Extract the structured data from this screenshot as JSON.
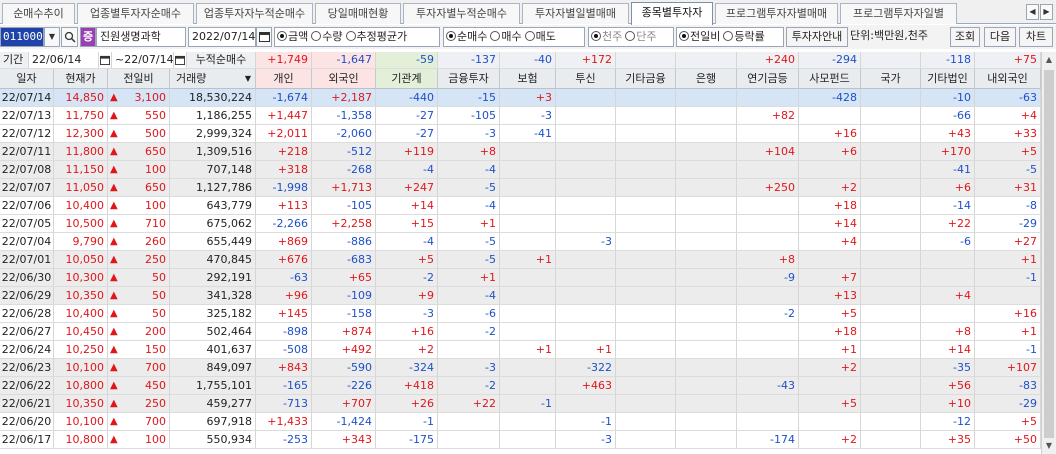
{
  "tabs": [
    "순매수추이",
    "업종별투자자순매수",
    "업종투자자누적순매수",
    "당일매매현황",
    "투자자별누적순매수",
    "투자자별일별매매",
    "종목별투자자",
    "프로그램투자자별매매",
    "프로그램투자자일별"
  ],
  "active_tab": 6,
  "toolbar": {
    "code": "011000",
    "stock_badge": "증",
    "stock_name": "진원생명과학",
    "date": "2022/07/14",
    "radio1": [
      {
        "label": "금액",
        "on": true
      },
      {
        "label": "수량",
        "on": false
      },
      {
        "label": "추정평균가",
        "on": false
      }
    ],
    "radio2": [
      {
        "label": "순매수",
        "on": true
      },
      {
        "label": "매수",
        "on": false
      },
      {
        "label": "매도",
        "on": false
      }
    ],
    "radio3": [
      {
        "label": "천주",
        "on": true
      },
      {
        "label": "단주",
        "on": false
      }
    ],
    "radio4": [
      {
        "label": "전일비",
        "on": true
      },
      {
        "label": "등락률",
        "on": false
      }
    ],
    "investor_info": "투자자안내",
    "unit_label": "단위:백만원,천주",
    "search": "조회",
    "next": "다음",
    "chart": "차트"
  },
  "period": {
    "label": "기간",
    "from": "22/06/14",
    "sep": "~",
    "to": "22/07/14",
    "sum_label": "누적순매수"
  },
  "summary": {
    "개인": "+1,749",
    "외국인": "-1,647",
    "기관계": "-59",
    "금융투자": "-137",
    "보험": "-40",
    "투신": "+172",
    "기타금융": "",
    "은행": "",
    "연기금등": "+240",
    "사모펀드": "-294",
    "국가": "",
    "기타법인": "-118",
    "내외국인": "+75"
  },
  "columns": [
    "일자",
    "현재가",
    "전일비",
    "거래량",
    "개인",
    "외국인",
    "기관계",
    "금융투자",
    "보험",
    "투신",
    "기타금융",
    "은행",
    "연기금등",
    "사모펀드",
    "국가",
    "기타법인",
    "내외국인"
  ],
  "rows": [
    [
      "22/07/14",
      "14,850",
      "up",
      "3,100",
      "18,530,224",
      "-1,674",
      "+2,187",
      "-440",
      "-15",
      "+3",
      "",
      "",
      "",
      "",
      "-428",
      "",
      "-10",
      "-63"
    ],
    [
      "22/07/13",
      "11,750",
      "up",
      "550",
      "1,186,255",
      "+1,447",
      "-1,358",
      "-27",
      "-105",
      "-3",
      "",
      "",
      "",
      "+82",
      "",
      "",
      "-66",
      "+4"
    ],
    [
      "22/07/12",
      "12,300",
      "up",
      "500",
      "2,999,324",
      "+2,011",
      "-2,060",
      "-27",
      "-3",
      "-41",
      "",
      "",
      "",
      "",
      "+16",
      "",
      "+43",
      "+33"
    ],
    [
      "22/07/11",
      "11,800",
      "up",
      "650",
      "1,309,516",
      "+218",
      "-512",
      "+119",
      "+8",
      "",
      "",
      "",
      "",
      "+104",
      "+6",
      "",
      "+170",
      "+5"
    ],
    [
      "22/07/08",
      "11,150",
      "up",
      "100",
      "707,148",
      "+318",
      "-268",
      "-4",
      "-4",
      "",
      "",
      "",
      "",
      "",
      "",
      "",
      "-41",
      "-5"
    ],
    [
      "22/07/07",
      "11,050",
      "up",
      "650",
      "1,127,786",
      "-1,998",
      "+1,713",
      "+247",
      "-5",
      "",
      "",
      "",
      "",
      "+250",
      "+2",
      "",
      "+6",
      "+31"
    ],
    [
      "22/07/06",
      "10,400",
      "up",
      "100",
      "643,779",
      "+113",
      "-105",
      "+14",
      "-4",
      "",
      "",
      "",
      "",
      "",
      "+18",
      "",
      "-14",
      "-8"
    ],
    [
      "22/07/05",
      "10,500",
      "up",
      "710",
      "675,062",
      "-2,266",
      "+2,258",
      "+15",
      "+1",
      "",
      "",
      "",
      "",
      "",
      "+14",
      "",
      "+22",
      "-29"
    ],
    [
      "22/07/04",
      "9,790",
      "up",
      "260",
      "655,449",
      "+869",
      "-886",
      "-4",
      "-5",
      "",
      "-3",
      "",
      "",
      "",
      "+4",
      "",
      "-6",
      "+27"
    ],
    [
      "22/07/01",
      "10,050",
      "up",
      "250",
      "470,845",
      "+676",
      "-683",
      "+5",
      "-5",
      "+1",
      "",
      "",
      "",
      "+8",
      "",
      "",
      "",
      "+1"
    ],
    [
      "22/06/30",
      "10,300",
      "up",
      "50",
      "292,191",
      "-63",
      "+65",
      "-2",
      "+1",
      "",
      "",
      "",
      "",
      "-9",
      "+7",
      "",
      "",
      "-1"
    ],
    [
      "22/06/29",
      "10,350",
      "up",
      "50",
      "341,328",
      "+96",
      "-109",
      "+9",
      "-4",
      "",
      "",
      "",
      "",
      "",
      "+13",
      "",
      "+4",
      ""
    ],
    [
      "22/06/28",
      "10,400",
      "up",
      "50",
      "325,182",
      "+145",
      "-158",
      "-3",
      "-6",
      "",
      "",
      "",
      "",
      "-2",
      "+5",
      "",
      "",
      "+16"
    ],
    [
      "22/06/27",
      "10,450",
      "up",
      "200",
      "502,464",
      "-898",
      "+874",
      "+16",
      "-2",
      "",
      "",
      "",
      "",
      "",
      "+18",
      "",
      "+8",
      "+1"
    ],
    [
      "22/06/24",
      "10,250",
      "up",
      "150",
      "401,637",
      "-508",
      "+492",
      "+2",
      "",
      "+1",
      "+1",
      "",
      "",
      "",
      "+1",
      "",
      "+14",
      "-1"
    ],
    [
      "22/06/23",
      "10,100",
      "up",
      "700",
      "849,097",
      "+843",
      "-590",
      "-324",
      "-3",
      "",
      "-322",
      "",
      "",
      "",
      "+2",
      "",
      "-35",
      "+107"
    ],
    [
      "22/06/22",
      "10,800",
      "up",
      "450",
      "1,755,101",
      "-165",
      "-226",
      "+418",
      "-2",
      "",
      "+463",
      "",
      "",
      "-43",
      "",
      "",
      "+56",
      "-83"
    ],
    [
      "22/06/21",
      "10,350",
      "up",
      "250",
      "459,277",
      "-713",
      "+707",
      "+26",
      "+22",
      "-1",
      "",
      "",
      "",
      "",
      "+5",
      "",
      "+10",
      "-29"
    ],
    [
      "22/06/20",
      "10,100",
      "up",
      "700",
      "697,918",
      "+1,433",
      "-1,424",
      "-1",
      "",
      "",
      "-1",
      "",
      "",
      "",
      "",
      "",
      "-12",
      "+5"
    ],
    [
      "22/06/17",
      "10,800",
      "up",
      "100",
      "550,934",
      "-253",
      "+343",
      "-175",
      "",
      "",
      "-3",
      "",
      "",
      "-174",
      "+2",
      "",
      "+35",
      "+50"
    ]
  ],
  "colors": {
    "up": "#e0161b",
    "down": "#1e50c8",
    "selected_row": "#d5e5f5",
    "gray_row": "#ececec",
    "code_bg": "#1f43a8",
    "badge_bg": "#9b3fb4"
  },
  "icons": {
    "search": "magnifier-icon",
    "calendar": "calendar-icon",
    "sort": "sort-down-icon",
    "scroll_up": "arrow-up-icon",
    "scroll_down": "arrow-down-icon"
  }
}
